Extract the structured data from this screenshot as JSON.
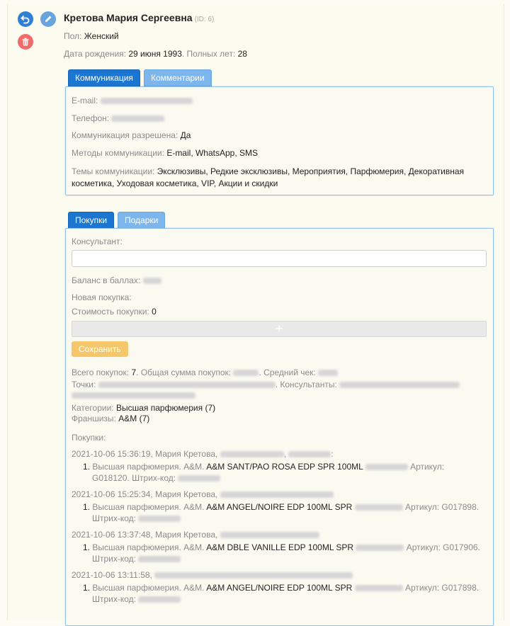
{
  "profile": {
    "name": "Кретова Мария Сергеевна",
    "id_tag": "(ID: 6)",
    "gender_label": "Пол:",
    "gender_value": "Женский",
    "dob_label": "Дата рождения:",
    "dob_value": "29 июня 1993",
    "age_label": ". Полных лет:",
    "age_value": "28"
  },
  "comm_tabs": [
    "Коммуникация",
    "Комментарии"
  ],
  "communication": {
    "email_label": "E-mail:",
    "phone_label": "Телефон:",
    "allowed_label": "Коммуникация разрешена:",
    "allowed_value": "Да",
    "methods_label": "Методы коммуникации:",
    "methods_value": "E-mail, WhatsApp, SMS",
    "topics_label": "Темы коммуникации:",
    "topics_value_line1": "Эксклюзивы, Редкие эксклюзивы, Мероприятия, Парфюмерия, Декоративная",
    "topics_value_line2": "косметика, Уходовая косметика, VIP, Акции и скидки"
  },
  "purchase_tabs": [
    "Покупки",
    "Подарки"
  ],
  "purchase_form": {
    "consultant_label": "Консультант:",
    "balance_label": "Баланс в баллах:",
    "new_purchase_label": "Новая покупка:",
    "cost_label": "Стоимость покупки:",
    "cost_value": "0",
    "add_symbol": "+",
    "save_label": "Сохранить"
  },
  "summary": {
    "total_label": "Всего покупок:",
    "total_value": "7",
    "sum_label": ". Общая сумма покупок:",
    "avg_label": ". Средний чек:",
    "points_label": "Точки:",
    "consultants_label": ". Консультанты:",
    "categories_label": "Категории:",
    "categories_value": "Высшая парфюмерия (7)",
    "franchises_label": "Франшизы:",
    "franchises_value": "A&M (7)",
    "purchases_label": "Покупки:"
  },
  "purchases": [
    {
      "header": "2021-10-06 15:36:19, Мария Кретова,",
      "num": "1.",
      "category": "Высшая парфюмерия. A&M.",
      "product": "A&M SANT/PAO ROSA EDP SPR 100ML",
      "article_label": "Артикул:",
      "article": "G018120.",
      "barcode_label": "Штрих-код:"
    },
    {
      "header": "2021-10-06 15:25:34, Мария Кретова,",
      "num": "1.",
      "category": "Высшая парфюмерия. A&M.",
      "product": "A&M ANGEL/NOIRE EDP 100ML SPR",
      "article_label": "Артикул:",
      "article": "G017898.",
      "barcode_label": "Штрих-код:"
    },
    {
      "header": "2021-10-06 13:37:48, Мария Кретова,",
      "num": "1.",
      "category": "Высшая парфюмерия. A&M.",
      "product": "A&M DBLE VANILLE EDP 100ML SPR",
      "article_label": "Артикул:",
      "article": "G017906.",
      "barcode_label": "Штрих-код:"
    },
    {
      "header": "2021-10-06 13:11:58,",
      "num": "1.",
      "category": "Высшая парфюмерия. A&M.",
      "product": "A&M ANGEL/NOIRE EDP 100ML SPR",
      "article_label": "Артикул:",
      "article": "G017898.",
      "barcode_label": "Штрих-код:"
    }
  ],
  "icons": {
    "back": "undo-icon",
    "edit": "pencil-icon",
    "delete": "trash-icon"
  },
  "colors": {
    "accent": "#1a76d1",
    "tab_inactive": "#7cb6ec",
    "delete": "#f06b6b",
    "save": "#f6c76a"
  }
}
